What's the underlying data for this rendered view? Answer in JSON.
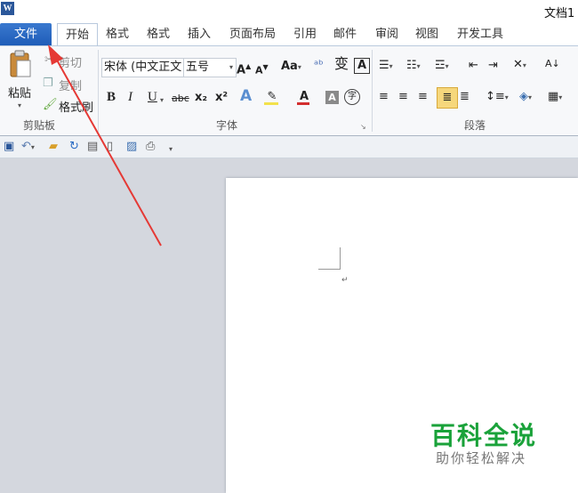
{
  "titlebar": {
    "app_icon": "W",
    "doc_title": "文档1"
  },
  "tabs": [
    "文件",
    "开始",
    "格式",
    "格式",
    "插入",
    "页面布局",
    "引用",
    "邮件",
    "审阅",
    "视图",
    "开发工具"
  ],
  "clipboard": {
    "paste": "粘贴",
    "cut": "剪切",
    "copy": "复制",
    "format_painter": "格式刷",
    "group": "剪贴板"
  },
  "font": {
    "name": "宋体 (中文正文",
    "size": "五号",
    "group": "字体",
    "grow": "A",
    "shrink": "A",
    "case": "Aa",
    "bold": "B",
    "italic": "I",
    "underline": "U",
    "strike": "abc",
    "sub": "x₂",
    "sup": "x²"
  },
  "paragraph": {
    "group": "段落"
  },
  "watermark": {
    "title": "百科全说",
    "subtitle": "助你轻松解决"
  },
  "colors": {
    "file_tab": "#2b6cc4",
    "arrow": "#e53935",
    "watermark_green": "#1aa23a",
    "highlight_yellow": "#f2e14c",
    "font_red": "#d32f2f"
  },
  "icons": [
    "word-app-icon",
    "paste-icon",
    "cut-icon",
    "copy-icon",
    "format-painter-icon",
    "save-icon",
    "undo-icon",
    "open-folder-icon",
    "refresh-icon",
    "new-doc-icon",
    "print-preview-icon",
    "paragraph-mark-icon"
  ]
}
